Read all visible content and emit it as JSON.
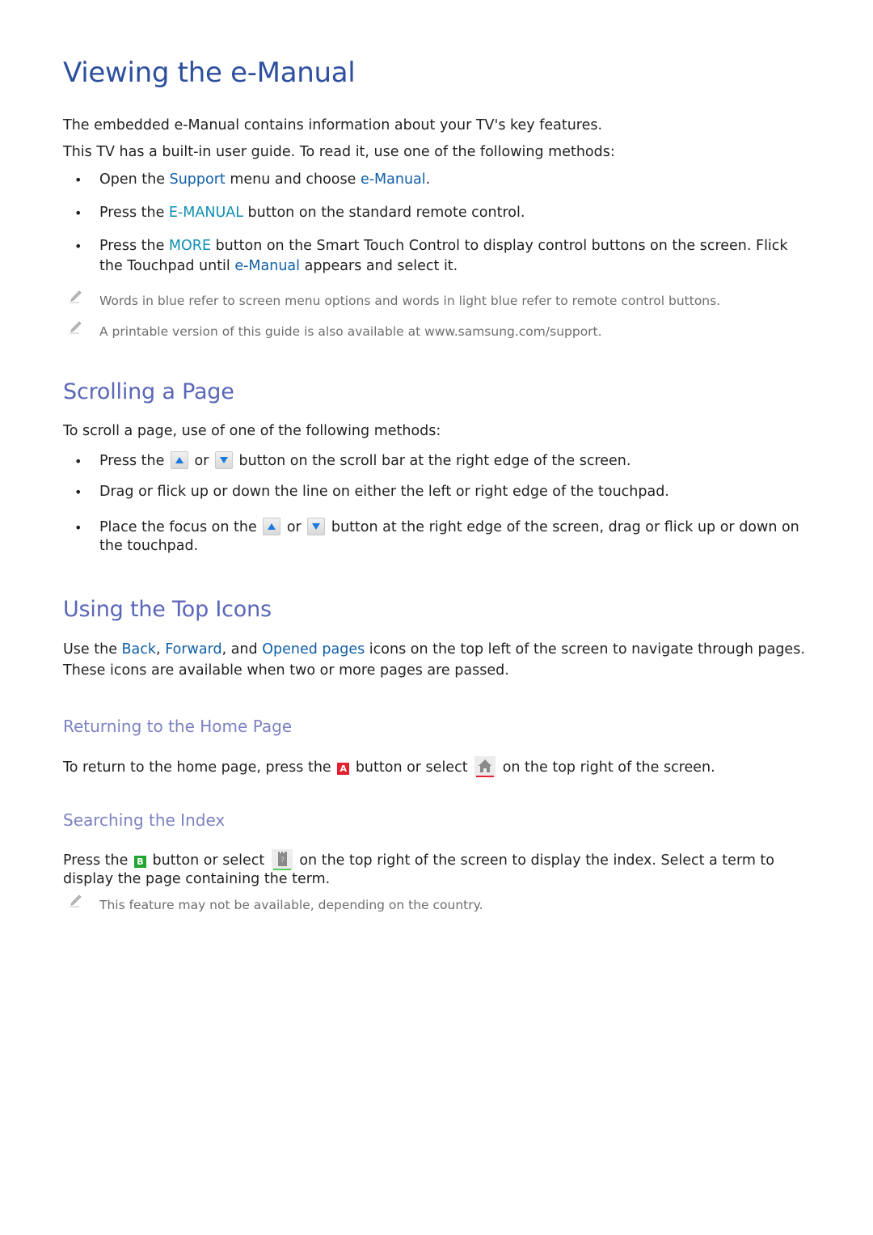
{
  "sections": {
    "viewing": {
      "title": "Viewing the e-Manual",
      "intro1": "The embedded e-Manual contains information about your TV's key features.",
      "intro2": "This TV has a built-in user guide. To read it, use one of the following methods:",
      "bullets": [
        {
          "pre": "Open the ",
          "link1": "Support",
          "mid": " menu and choose ",
          "link2": "e-Manual",
          "post": "."
        },
        {
          "pre": "Press the ",
          "link1": "E-MANUAL",
          "post": " button on the standard remote control."
        },
        {
          "pre": "Press the ",
          "link1": "MORE",
          "mid": " button on the Smart Touch Control to display control buttons on the screen. Flick the Touchpad until ",
          "link2": "e-Manual",
          "post": " appears and select it."
        }
      ],
      "notes": [
        "Words in blue refer to screen menu options and words in light blue refer to remote control buttons.",
        "A printable version of this guide is also available at www.samsung.com/support."
      ]
    },
    "scrolling": {
      "title": "Scrolling a Page",
      "intro": "To scroll a page, use of one of the following methods:",
      "bullet1": {
        "pre": "Press the ",
        "mid": " or ",
        "post": " button on the scroll bar at the right edge of the screen."
      },
      "bullet2": "Drag or flick up or down the line on either the left or right edge of the touchpad.",
      "bullet3": {
        "pre": "Place the focus on the ",
        "mid": " or ",
        "post": " button at the right edge of the screen, drag or flick up or down on the touchpad."
      }
    },
    "top_icons": {
      "title": "Using the Top Icons",
      "text": {
        "pre": "Use the ",
        "back": "Back",
        "sep1": ", ",
        "forward": "Forward",
        "sep2": ", and ",
        "opened": "Opened pages",
        "post": " icons on the top left of the screen to navigate through pages. These icons are available when two or more pages are passed."
      }
    },
    "home": {
      "title": "Returning to the Home Page",
      "text": {
        "pre": "To return to the home page, press the ",
        "key": "A",
        "mid": " button or select ",
        "post": " on the top right of the screen."
      }
    },
    "index": {
      "title": "Searching the Index",
      "text": {
        "pre": "Press the ",
        "key": "B",
        "mid": " button or select ",
        "icon_glyph": "?",
        "post": " on the top right of the screen to display the index. Select a term to display the page containing the term."
      },
      "note": "This feature may not be available, depending on the country."
    }
  },
  "colors": {
    "title": "#2d4f9e",
    "heading2": "#5a67b8",
    "heading3": "#7c82c0",
    "menu_link": "#0f5fa8",
    "remote_link": "#0f8fb4",
    "key_a": "#e5202e",
    "key_b": "#22a532"
  }
}
